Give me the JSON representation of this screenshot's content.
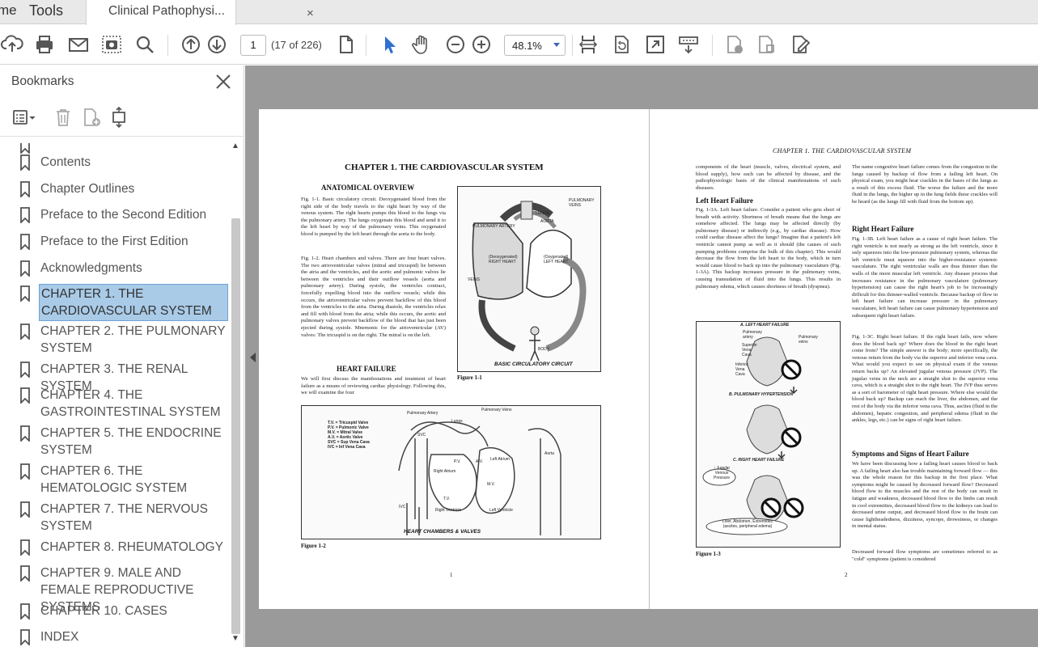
{
  "tabs": {
    "home": "me",
    "tools": "Tools",
    "document": "Clinical Pathophysi...",
    "close": "×"
  },
  "toolbar": {
    "icons": [
      "upload-icon",
      "print-icon",
      "email-icon",
      "snapshot-icon",
      "search-icon",
      "prev-page-icon",
      "next-page-icon",
      "page-fit-icon",
      "select-tool-icon",
      "hand-tool-icon",
      "zoom-out-icon",
      "zoom-in-icon",
      "fit-width-icon",
      "rotate-icon",
      "fullscreen-icon",
      "scroll-mode-icon",
      "comment-icon",
      "stamp-icon",
      "sign-icon"
    ],
    "page_number": "1",
    "page_count": "(17 of 226)",
    "zoom": "48.1%"
  },
  "bookmarks": {
    "title": "Bookmarks",
    "items": [
      {
        "label": "Contents"
      },
      {
        "label": "Chapter Outlines"
      },
      {
        "label": "Preface to the Second Edition"
      },
      {
        "label": "Preface to the First Edition"
      },
      {
        "label": "Acknowledgments"
      },
      {
        "label": "CHAPTER 1. THE CARDIOVASCULAR SYSTEM"
      },
      {
        "label": "CHAPTER 2. THE PULMONARY SYSTEM"
      },
      {
        "label": "CHAPTER 3. THE RENAL SYSTEM"
      },
      {
        "label": "CHAPTER 4. THE GASTROINTESTINAL SYSTEM"
      },
      {
        "label": "CHAPTER 5. THE ENDOCRINE SYSTEM"
      },
      {
        "label": "CHAPTER 6. THE HEMATOLOGIC SYSTEM"
      },
      {
        "label": "CHAPTER 7. THE NERVOUS SYSTEM"
      },
      {
        "label": "CHAPTER 8. RHEUMATOLOGY"
      },
      {
        "label": "CHAPTER 9. MALE AND FEMALE REPRODUCTIVE SYSTEMS"
      },
      {
        "label": "CHAPTER 10. CASES"
      },
      {
        "label": "INDEX"
      }
    ],
    "selected_index": 5
  },
  "page_left": {
    "chapter_title": "CHAPTER 1. THE CARDIOVASCULAR SYSTEM",
    "section_anatomical": "ANATOMICAL OVERVIEW",
    "fig11_text": "Fig. 1-1. Basic circulatory circuit. Deoxygenated blood from the right side of the body travels to the right heart by way of the venous system. The right hearts pumps this blood to the lungs via the pulmonary artery. The lungs oxygenate this blood and send it to the left heart by way of the pulmonary veins. This oxygenated blood is pumped by the left heart through the aorta to the body.",
    "fig12_text": "Fig. 1-2. Heart chambers and valves. There are four heart valves. The two atrioventricular valves (mitral and tricuspid) lie between the atria and the ventricles, and the aortic and pulmonic valves lie between the ventricles and their outflow vessels (aorta and pulmonary artery). During systole, the ventricles contract, forcefully expelling blood into the outflow vessels; while this occurs, the atrioventricular valves prevent backflow of this blood from the ventricles to the atria. During diastole, the ventricles relax and fill with blood from the atria; while this occurs, the aortic and pulmonary valves prevent backflow of the blood that has just been ejected during systole. Mnemonic for the atrioventricular (AV) valves: The tricuspid is on the right. The mitral is on the left.",
    "section_heart_failure": "HEART FAILURE",
    "hf_text": "We will first discuss the manifestations and treatment of heart failure as a means of reviewing cardiac physiology. Following this, we will examine the four",
    "fig1_title": "BASIC CIRCULATORY CIRCUIT",
    "fig1_caption": "Figure 1-1",
    "fig2_title": "HEART CHAMBERS & VALVES",
    "fig2_caption": "Figure 1-2",
    "fig2_legend": [
      "T.V. = Tricuspid Valve",
      "P.V. = Pulmonic Valve",
      "M.V. = Mitral Valve",
      "A.V. = Aortic Valve",
      "SVC = Sup Vena Cava",
      "IVC = Inf Vena Cava"
    ],
    "fig1_labels": [
      "PULMONARY ARTERY",
      "PULMONARY VEINS",
      "LUNGS",
      "(Deoxygenated) RIGHT HEART",
      "(Oxygenated) LEFT HEART",
      "AORTA",
      "VEINS",
      "BODY"
    ],
    "fig2_labels": [
      "Pulmonary Artery",
      "Lungs",
      "Pulmonary Veins",
      "SVC",
      "Right Atrium",
      "P.V.",
      "A.V.",
      "Left Atrium",
      "Aorta",
      "T.V.",
      "M.V.",
      "Right Ventricle",
      "Left Ventricle",
      "IVC"
    ],
    "page_number": "1"
  },
  "page_right": {
    "running_head": "CHAPTER 1. THE CARDIOVASCULAR SYSTEM",
    "col1_intro": "components of the heart (muscle, valves, electrical system, and blood supply), how each can be affected by disease, and the pathophysiologic basis of the clinical manifestations of such diseases.",
    "section_left_hf": "Left Heart Failure",
    "left_hf_text": "Fig. 1-3A. Left heart failure. Consider a patient who gets short of breath with activity. Shortness of breath means that the lungs are somehow affected. The lungs may be affected directly (by pulmonary disease) or indirectly (e.g., by cardiac disease). How could cardiac disease affect the lungs? Imagine that a patient's left ventricle cannot pump as well as it should (the causes of such pumping problems comprise the bulk of this chapter). This would decrease the flow from the left heart to the body, which in turn would cause blood to back up into the pulmonary vasculature (Fig. 1-3A). This backup increases pressure in the pulmonary veins, causing transudation of fluid into the lungs. This results in pulmonary edema, which causes shortness of breath (dyspnea).",
    "fig3_caption": "Figure 1-3",
    "fig3_panels": [
      "A. LEFT HEART FAILURE",
      "B. PULMONARY HYPERTENSION",
      "C. RIGHT HEART FAILURE"
    ],
    "fig3_labels": [
      "Pulmonary artery",
      "Pulmonary veins",
      "Superior Vena Cava",
      "Inferior Vena Cava",
      "↑ Jugular Venous Pressure",
      "Liver, Abdomen, Extremities (ascites, peripheral edema)"
    ],
    "col2_intro": "The name congestive heart failure comes from the congestion in the lungs caused by backup of flow from a failing left heart. On physical exam, you might hear crackles in the bases of the lungs as a result of this excess fluid. The worse the failure and the more fluid in the lungs, the higher up in the lung fields these crackles will be heard (as the lungs fill with fluid from the bottom up).",
    "section_right_hf": "Right Heart Failure",
    "right_hf_text": "Fig. 1-3B. Left heart failure as a cause of right heart failure. The right ventricle is not nearly as strong as the left ventricle, since it only squeezes into the low-pressure pulmonary system, whereas the left ventricle must squeeze into the higher-resistance systemic vasculature. The right ventricular walls are thus thinner than the walls of the more muscular left ventricle. Any disease process that increases resistance in the pulmonary vasculature (pulmonary hypertension) can cause the right heart's job to be increasingly difficult for this thinner-walled ventricle. Because backup of flow in left heart failure can increase pressure in the pulmonary vasculature, left heart failure can cause pulmonary hypertension and subsequent right heart failure.",
    "fig13c_text": "Fig. 1-3C. Right heart failure. If the right heart fails, now where does the blood back up? Where does the blood in the right heart come from? The simple answer is the body; more specifically, the venous return from the body via the superior and inferior vena cava. What would you expect to see on physical exam if the venous return backs up? An elevated jugular venous pressure (JVP). The jugular veins in the neck are a straight shot to the superior vena cava, which is a straight shot to the right heart. The JVP thus serves as a sort of barometer of right heart pressure. Where else would the blood back up? Backup can reach the liver, the abdomen, and the rest of the body via the inferior vena cava. Thus, ascites (fluid in the abdomen), hepatic congestion, and peripheral edema (fluid in the ankles, legs, etc.) can be signs of right heart failure.",
    "section_symptoms": "Symptoms and Signs of Heart Failure",
    "symptoms_text": "We have been discussing how a failing heart causes blood to back up. A failing heart also has trouble maintaining forward flow — this was the whole reason for this backup in the first place. What symptoms might be caused by decreased forward flow? Decreased blood flow to the muscles and the rest of the body can result in fatigue and weakness, decreased blood flow to the limbs can result in cool extremities, decreased blood flow to the kidneys can lead to decreased urine output, and decreased blood flow to the brain can cause lightheadedness, dizziness, syncope, drowsiness, or changes in mental status.",
    "last_text": "Decreased forward flow symptoms are sometimes referred to as \"cold\" symptoms (patient is considered",
    "page_number": "2"
  }
}
